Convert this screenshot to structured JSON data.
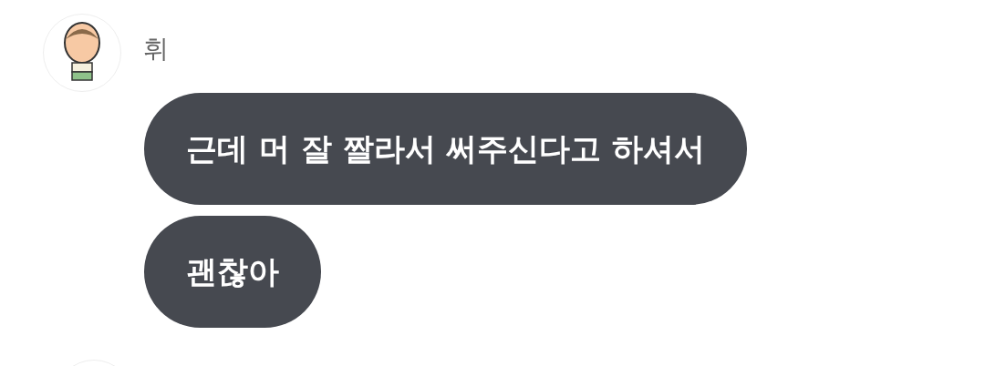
{
  "sender": {
    "name": "휘"
  },
  "messages": [
    {
      "text": "근데 머 잘 짤라서 써주신다고 하셔서"
    },
    {
      "text": "괜찮아"
    }
  ]
}
